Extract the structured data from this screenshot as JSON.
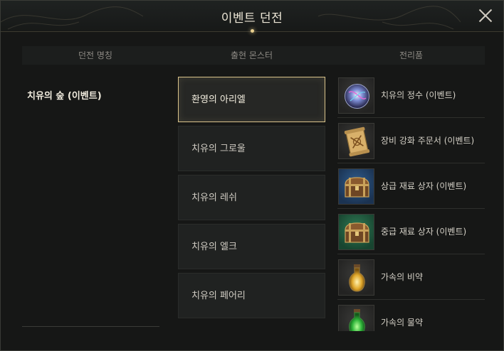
{
  "window": {
    "title": "이벤트 던전"
  },
  "columns": {
    "dungeon": "던전 명칭",
    "monster": "출현 몬스터",
    "reward": "전리품"
  },
  "dungeon": {
    "name": "치유의 숲 (이벤트)"
  },
  "monsters": [
    {
      "label": "환영의 아리엘",
      "selected": true
    },
    {
      "label": "치유의 그로울",
      "selected": false
    },
    {
      "label": "치유의 레쉬",
      "selected": false
    },
    {
      "label": "치유의 엘크",
      "selected": false
    },
    {
      "label": "치유의 페어리",
      "selected": false
    }
  ],
  "rewards": [
    {
      "label": "치유의 정수 (이벤트)",
      "icon": "essence-orb-icon",
      "bg": "#2a2a28"
    },
    {
      "label": "장비 강화 주문서 (이벤트)",
      "icon": "scroll-icon",
      "bg": "#2a2a28"
    },
    {
      "label": "상급 재료 상자 (이벤트)",
      "icon": "chest-icon",
      "bg": "#24466d"
    },
    {
      "label": "중급 재료 상자 (이벤트)",
      "icon": "chest-icon",
      "bg": "#205e3f"
    },
    {
      "label": "가속의 비약",
      "icon": "golden-potion-icon",
      "bg": "#2a2a28"
    },
    {
      "label": "가속의 물약",
      "icon": "green-potion-icon",
      "bg": "#2a2a28"
    }
  ]
}
